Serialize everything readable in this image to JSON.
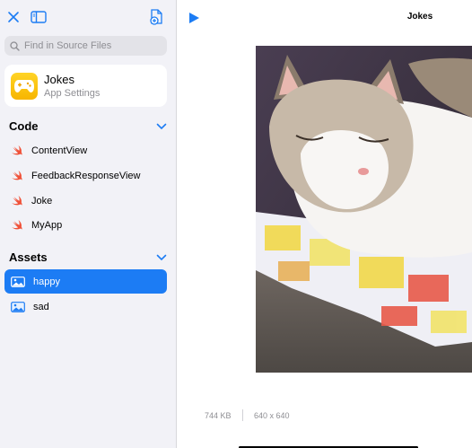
{
  "sidebar": {
    "search": {
      "placeholder": "Find in Source Files"
    },
    "app": {
      "name": "Jokes",
      "subtitle": "App Settings"
    },
    "sections": {
      "code": {
        "title": "Code",
        "items": [
          {
            "label": "ContentView",
            "icon": "swift-icon"
          },
          {
            "label": "FeedbackResponseView",
            "icon": "swift-icon"
          },
          {
            "label": "Joke",
            "icon": "swift-icon"
          },
          {
            "label": "MyApp",
            "icon": "swift-icon"
          }
        ]
      },
      "assets": {
        "title": "Assets",
        "items": [
          {
            "label": "happy",
            "icon": "image-icon",
            "selected": true
          },
          {
            "label": "sad",
            "icon": "image-icon",
            "selected": false
          }
        ]
      }
    }
  },
  "main": {
    "title": "Jokes",
    "image_meta": {
      "size": "744 KB",
      "dimensions": "640 x 640"
    }
  },
  "colors": {
    "accent": "#1c7cf4",
    "swift": "#f05138",
    "sidebar_bg": "#f2f2f7"
  }
}
